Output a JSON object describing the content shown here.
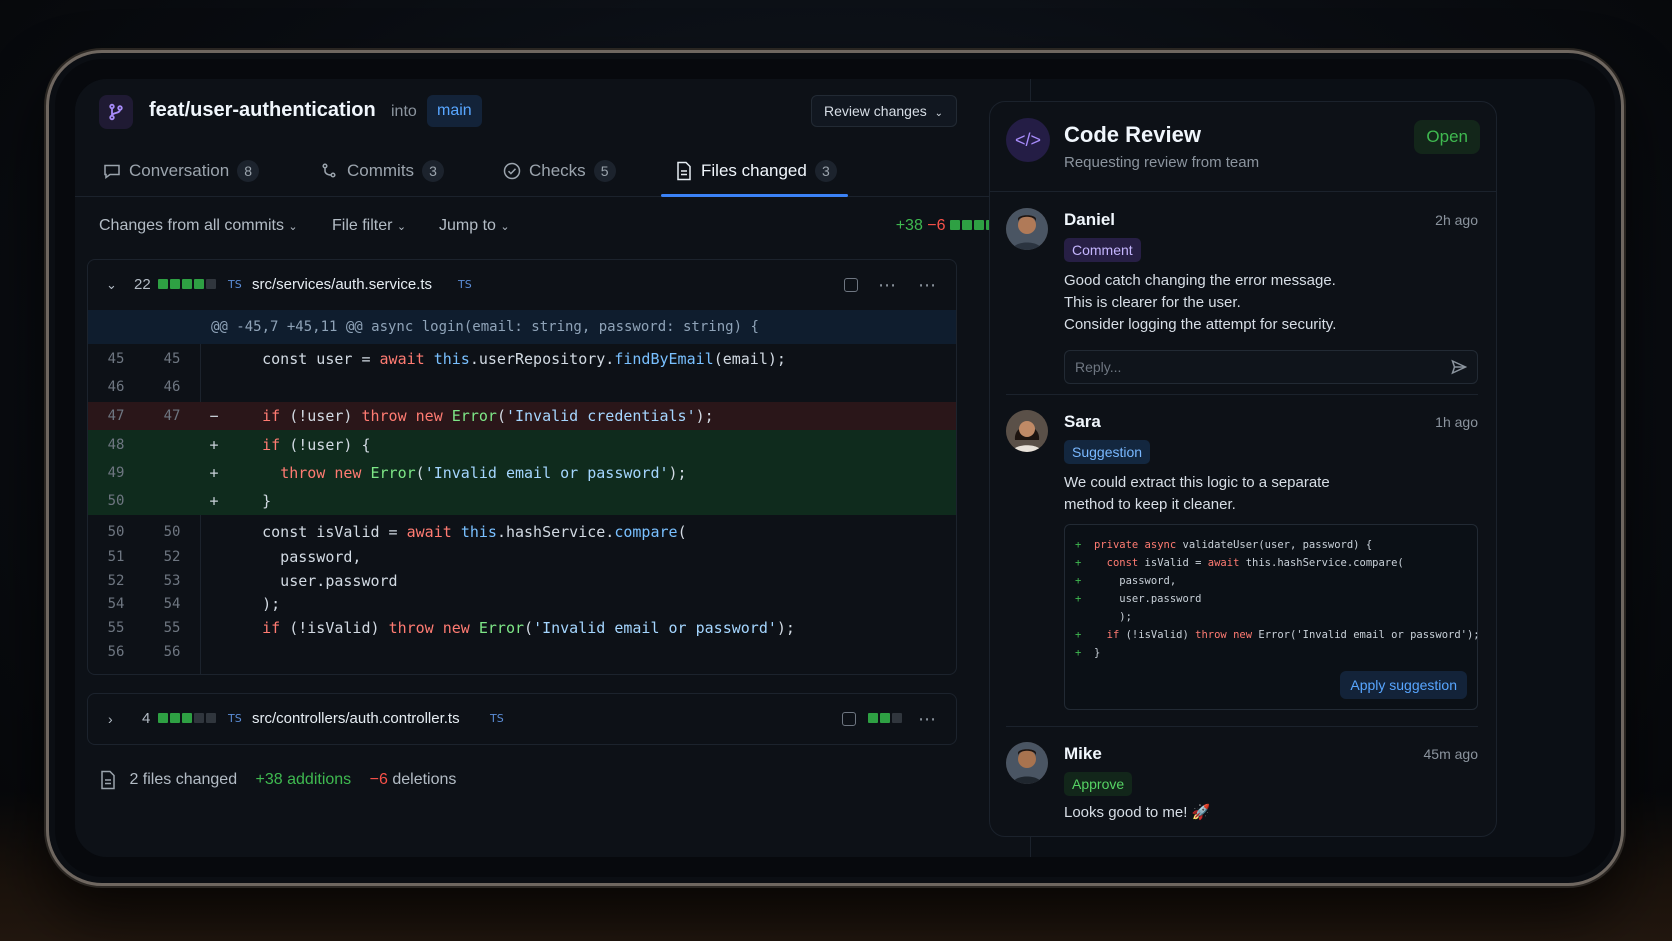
{
  "pr": {
    "title": "feat/user-authentication",
    "into": "into",
    "base_branch": "main",
    "review_button": "Review changes"
  },
  "tabs": [
    {
      "label": "Conversation",
      "count": "8"
    },
    {
      "label": "Commits",
      "count": "3"
    },
    {
      "label": "Checks",
      "count": "5"
    },
    {
      "label": "Files changed",
      "count": "3"
    }
  ],
  "filters": {
    "changes": "Changes from all commits",
    "file_filter": "File filter",
    "jump_to": "Jump to",
    "additions": "+38",
    "deletions": "−6"
  },
  "file1": {
    "changes": "22",
    "lang": "TS",
    "path": "src/services/auth.service.ts",
    "hunk": "@@ -45,7 +45,11 @@ async login(email: string, password: string) {"
  },
  "file2": {
    "changes": "4",
    "lang": "TS",
    "path": "src/controllers/auth.controller.ts"
  },
  "summary": {
    "files": "2 files changed",
    "additions": "+38 additions",
    "deletions_num": "−6",
    "deletions_label": "deletions"
  },
  "review": {
    "title": "Code Review",
    "subtitle": "Requesting review from team",
    "status": "Open",
    "reply_placeholder": "Reply...",
    "apply_label": "Apply suggestion",
    "comments": [
      {
        "name": "Daniel",
        "time": "2h ago",
        "tag": "Comment",
        "lines": [
          "Good catch changing the error message.",
          "This is clearer for the user.",
          "Consider logging the attempt for security."
        ]
      },
      {
        "name": "Sara",
        "time": "1h ago",
        "tag": "Suggestion",
        "lines": [
          "We could extract this logic to a separate",
          "method to keep it cleaner."
        ]
      },
      {
        "name": "Mike",
        "time": "45m ago",
        "tag": "Approve",
        "lines": [
          "Looks good to me! 🚀"
        ]
      }
    ]
  },
  "colors": {
    "accent": "#3b82f6",
    "addition": "#3fb950",
    "deletion": "#f85149",
    "open": "#3fb950"
  }
}
